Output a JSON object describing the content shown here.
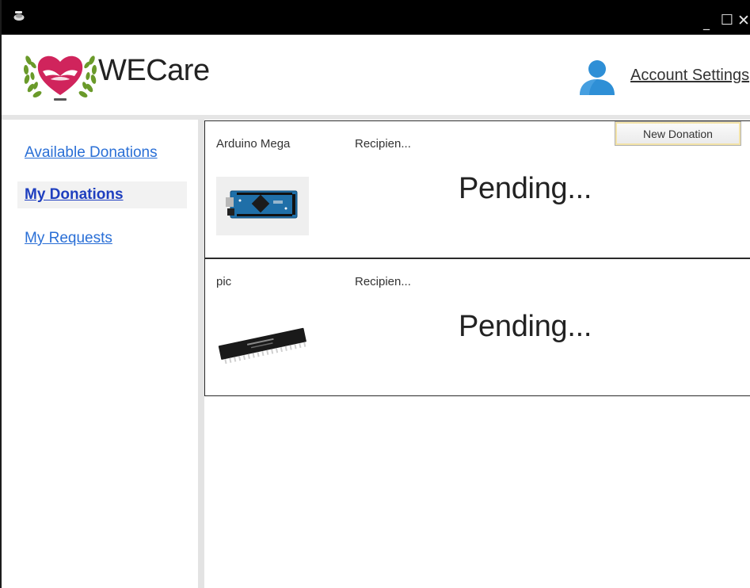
{
  "window": {
    "controls": {
      "minimize": "_",
      "maximize": "☐",
      "close": "✕"
    }
  },
  "header": {
    "app_name": "WECare",
    "logo_icon": "heart-hands-wreath-logo",
    "user_icon": "user-avatar-icon",
    "account_settings_label": "Account Settings"
  },
  "sidebar": {
    "items": [
      {
        "label": "Available Donations",
        "selected": false
      },
      {
        "label": "My Donations",
        "selected": true
      },
      {
        "label": "My Requests",
        "selected": false
      }
    ]
  },
  "toolbar": {
    "new_donation_label": "New Donation"
  },
  "donations": [
    {
      "name": "Arduino Mega",
      "recipient": "Recipien...",
      "status": "Pending...",
      "image": "arduino-board-image"
    },
    {
      "name": "pic",
      "recipient": "Recipien...",
      "status": "Pending...",
      "image": "pic-chip-image"
    }
  ],
  "colors": {
    "titlebar": "#000000",
    "link": "#2a6fd6",
    "selected_link": "#1f3fbf",
    "logo_heart": "#d0245c",
    "wreath": "#6a9a2a",
    "user_icon": "#2e8fd6"
  }
}
